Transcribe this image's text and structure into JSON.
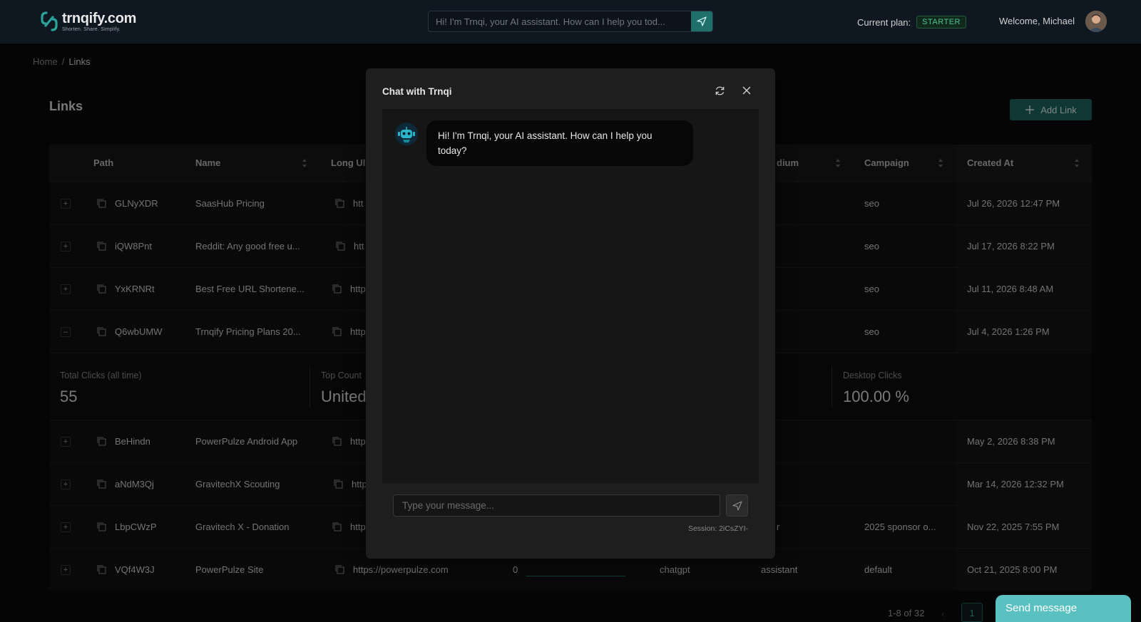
{
  "header": {
    "brand": "trnqify.com",
    "tagline": "Shorten. Share. Simplify.",
    "search_placeholder": "Hi! I'm Trnqi, your AI assistant. How can I help you tod...",
    "plan_label": "Current plan:",
    "plan_badge": "STARTER",
    "welcome": "Welcome, Michael"
  },
  "breadcrumb": {
    "home": "Home",
    "sep": "/",
    "current": "Links"
  },
  "page": {
    "title": "Links",
    "add_button": "Add Link"
  },
  "table": {
    "columns": {
      "path": "Path",
      "name": "Name",
      "long_url": "Long Ul",
      "medium": "dium",
      "campaign": "Campaign",
      "created": "Created At"
    },
    "rows": [
      {
        "expand": "+",
        "path": "GLNyXDR",
        "name": "SaasHub Pricing",
        "url": "htt",
        "medium": "",
        "campaign": "seo",
        "created": "Jul 26, 2026 12:47 PM"
      },
      {
        "expand": "+",
        "path": "iQW8Pnt",
        "name": "Reddit: Any good free u...",
        "url": "htt",
        "medium": "",
        "campaign": "seo",
        "created": "Jul 17, 2026 8:22 PM"
      },
      {
        "expand": "+",
        "path": "YxKRNRt",
        "name": "Best Free URL Shortene...",
        "url": "http",
        "medium": "",
        "campaign": "seo",
        "created": "Jul 11, 2026 8:48 AM"
      },
      {
        "expand": "–",
        "path": "Q6wbUMW",
        "name": "Trnqify Pricing Plans 20...",
        "url": "http",
        "medium": "",
        "campaign": "seo",
        "created": "Jul 4, 2026 1:26 PM"
      }
    ],
    "expanded_stats": {
      "total_label": "Total Clicks (all time)",
      "total_value": "55",
      "country_label": "Top Count",
      "country_value": "United",
      "desktop_label": "Desktop Clicks",
      "desktop_value": "100.00 %"
    },
    "rows2": [
      {
        "expand": "+",
        "path": "BeHindn",
        "name": "PowerPulze Android App",
        "url": "http",
        "clicks": "",
        "source": "",
        "medium": "",
        "campaign": "",
        "created": "May 2, 2026 8:38 PM"
      },
      {
        "expand": "+",
        "path": "aNdM3Qj",
        "name": "GravitechX Scouting",
        "url": "http",
        "clicks": "",
        "source": "",
        "medium": "",
        "campaign": "",
        "created": "Mar 14, 2026 12:32 PM"
      },
      {
        "expand": "+",
        "path": "LbpCWzP",
        "name": "Gravitech X - Donation",
        "url": "http",
        "clicks": "",
        "source": "",
        "medium": "r",
        "campaign": "2025 sponsor o...",
        "created": "Nov 22, 2025 7:55 PM"
      },
      {
        "expand": "+",
        "path": "VQf4W3J",
        "name": "PowerPulze Site",
        "url": "https://powerpulze.com",
        "clicks": "0",
        "source": "chatgpt",
        "medium": "assistant",
        "campaign": "default",
        "created": "Oct 21, 2025 8:00 PM"
      }
    ]
  },
  "modal": {
    "title": "Chat with Trnqi",
    "bot_message": "Hi! I'm Trnqi, your AI assistant. How can I help you today?",
    "input_placeholder": "Type your message...",
    "session": "Session: 2iCsZYI-"
  },
  "footer": {
    "range": "1-8 of 32",
    "prev": "‹",
    "page": "1",
    "send_message": "Send message"
  },
  "colors": {
    "accent": "#1d6660",
    "teal_button": "#5ac1c0",
    "plan_badge": "#52c28a"
  }
}
